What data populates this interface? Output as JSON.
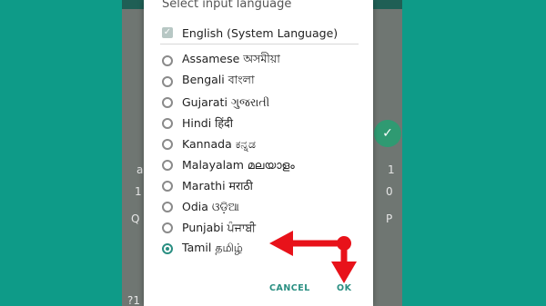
{
  "dialog": {
    "title": "Select input language",
    "system_language": {
      "label": "English (System Language)",
      "checked": true
    },
    "options": [
      {
        "label": "Assamese অসমীয়া",
        "selected": false
      },
      {
        "label": "Bengali বাংলা",
        "selected": false
      },
      {
        "label": "Gujarati ગુજરાતી",
        "selected": false
      },
      {
        "label": "Hindi हिंदी",
        "selected": false
      },
      {
        "label": "Kannada ಕನ್ನಡ",
        "selected": false
      },
      {
        "label": "Malayalam മലയാളം",
        "selected": false
      },
      {
        "label": "Marathi मराठी",
        "selected": false
      },
      {
        "label": "Odia ଓଡ଼ିଆ",
        "selected": false
      },
      {
        "label": "Punjabi ਪੰਜਾਬੀ",
        "selected": false
      },
      {
        "label": "Tamil தமிழ்",
        "selected": true
      }
    ],
    "cancel_label": "CANCEL",
    "ok_label": "OK"
  },
  "keyboard_fragments": {
    "left": [
      "a",
      "1",
      "Q",
      "?1"
    ],
    "right": [
      "1",
      "0",
      "P"
    ]
  },
  "colors": {
    "background": "#0e9b88",
    "accent": "#2a8f82",
    "annotation_arrow": "#e8121a"
  }
}
